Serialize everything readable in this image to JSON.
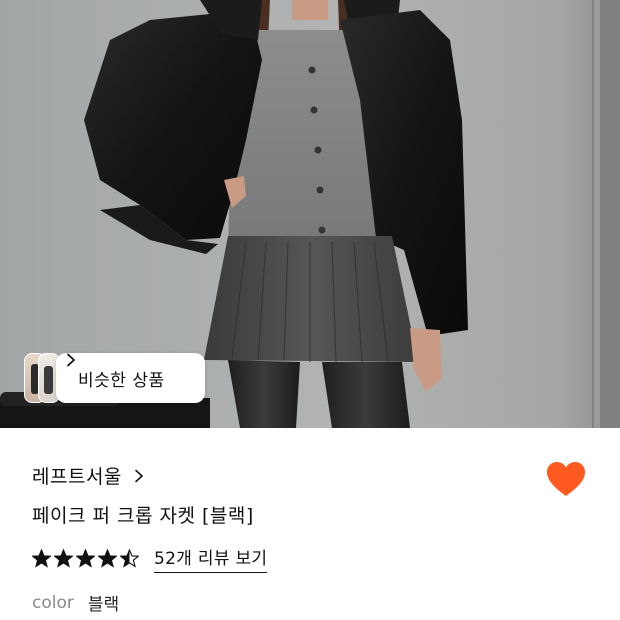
{
  "similar_products": {
    "label": "비슷한 상품"
  },
  "product": {
    "brand": "레프트서울",
    "name": "페이크 퍼 크롭 자켓 [블랙]",
    "rating": 4.5,
    "rating_max": 5,
    "review_link": "52개 리뷰 보기",
    "option_key": "color",
    "option_value": "블랙",
    "wishlisted": true
  },
  "colors": {
    "wish_heart": "#ff5a1f",
    "star": "#111111",
    "option_key": "#8a8a8a"
  },
  "icons": {
    "similar_chevron": "chevron-right-icon",
    "brand_chevron": "chevron-right-icon",
    "wish": "heart-icon",
    "rating": "star-icon"
  }
}
